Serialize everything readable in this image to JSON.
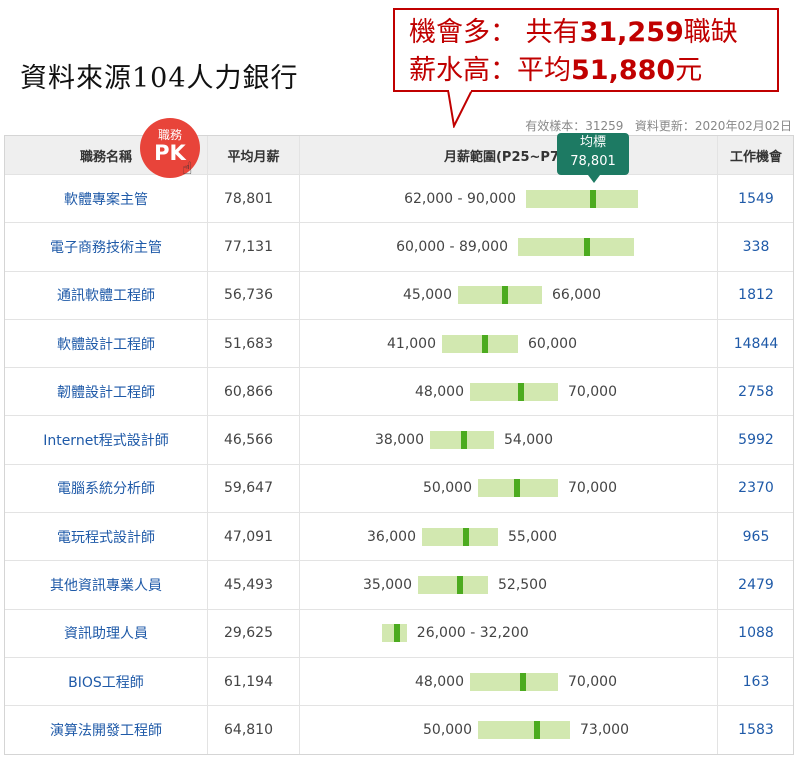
{
  "source_title": "資料來源104人力銀行",
  "callout": {
    "line1_prefix": "機會多： 共有",
    "line1_bold": "31,259",
    "line1_suffix": "職缺",
    "line2_prefix": "薪水高：平均",
    "line2_bold": "51,880",
    "line2_suffix": "元"
  },
  "meta": {
    "sample": "有效樣本：31259",
    "updated": "資料更新：2020年02月02日"
  },
  "pk_badge": {
    "top": "職務",
    "big": "PK"
  },
  "hand_icon": "pointing-hand-icon",
  "tooltip": {
    "label": "均標",
    "value": "78,801"
  },
  "headers": {
    "name": "職務名稱",
    "avg": "平均月薪",
    "range": "月薪範圍(P25~P75)",
    "jobs": "工作機會"
  },
  "axis": {
    "min": 20000,
    "max": 95000
  },
  "colors": {
    "bar": "#d2e8b0",
    "marker": "#4cab1f",
    "link": "#1f5aa8",
    "callout": "#c00000",
    "tooltip": "#1d7a63"
  },
  "rows": [
    {
      "name": "軟體專案主管",
      "avg": "78,801",
      "avg_value": 78801,
      "p25": 62000,
      "p75": 90000,
      "low_label": "62,000 - 90,000",
      "high_label": "",
      "combined": true,
      "jobs": "1549"
    },
    {
      "name": "電子商務技術主管",
      "avg": "77,131",
      "avg_value": 77131,
      "p25": 60000,
      "p75": 89000,
      "low_label": "60,000 - 89,000",
      "high_label": "",
      "combined": true,
      "jobs": "338"
    },
    {
      "name": "通訊軟體工程師",
      "avg": "56,736",
      "avg_value": 56736,
      "p25": 45000,
      "p75": 66000,
      "low_label": "45,000",
      "high_label": "66,000",
      "combined": false,
      "jobs": "1812"
    },
    {
      "name": "軟體設計工程師",
      "avg": "51,683",
      "avg_value": 51683,
      "p25": 41000,
      "p75": 60000,
      "low_label": "41,000",
      "high_label": "60,000",
      "combined": false,
      "jobs": "14844"
    },
    {
      "name": "韌體設計工程師",
      "avg": "60,866",
      "avg_value": 60866,
      "p25": 48000,
      "p75": 70000,
      "low_label": "48,000",
      "high_label": "70,000",
      "combined": false,
      "jobs": "2758"
    },
    {
      "name": "Internet程式設計師",
      "avg": "46,566",
      "avg_value": 46566,
      "p25": 38000,
      "p75": 54000,
      "low_label": "38,000",
      "high_label": "54,000",
      "combined": false,
      "jobs": "5992"
    },
    {
      "name": "電腦系統分析師",
      "avg": "59,647",
      "avg_value": 59647,
      "p25": 50000,
      "p75": 70000,
      "low_label": "50,000",
      "high_label": "70,000",
      "combined": false,
      "jobs": "2370"
    },
    {
      "name": "電玩程式設計師",
      "avg": "47,091",
      "avg_value": 47091,
      "p25": 36000,
      "p75": 55000,
      "low_label": "36,000",
      "high_label": "55,000",
      "combined": false,
      "jobs": "965"
    },
    {
      "name": "其他資訊專業人員",
      "avg": "45,493",
      "avg_value": 45493,
      "p25": 35000,
      "p75": 52500,
      "low_label": "35,000",
      "high_label": "52,500",
      "combined": false,
      "jobs": "2479"
    },
    {
      "name": "資訊助理人員",
      "avg": "29,625",
      "avg_value": 29625,
      "p25": 26000,
      "p75": 32200,
      "low_label": "26,000 - 32,200",
      "high_label": "",
      "combined": true,
      "jobs": "1088"
    },
    {
      "name": "BIOS工程師",
      "avg": "61,194",
      "avg_value": 61194,
      "p25": 48000,
      "p75": 70000,
      "low_label": "48,000",
      "high_label": "70,000",
      "combined": false,
      "jobs": "163"
    },
    {
      "name": "演算法開發工程師",
      "avg": "64,810",
      "avg_value": 64810,
      "p25": 50000,
      "p75": 73000,
      "low_label": "50,000",
      "high_label": "73,000",
      "combined": false,
      "jobs": "1583"
    }
  ]
}
